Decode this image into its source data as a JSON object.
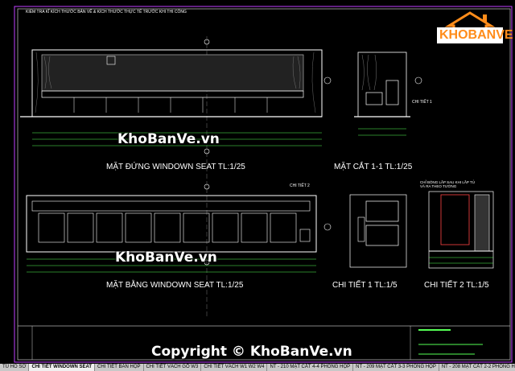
{
  "sheet": {
    "header_note": "KIỂM TRA KĨ KÍCH THƯỚC BẢN VẼ & KÍCH THƯỚC THỰC TẾ TRƯỚC KHI THI CÔNG",
    "titles": {
      "elevation": "MẶT ĐỨNG WINDOWN SEAT   TL:1/25",
      "section": "MẶT CẮT 1-1   TL:1/25",
      "plan": "MẶT BẰNG WINDOWN SEAT   TL:1/25",
      "detail1": "CHI TIẾT 1   TL:1/5",
      "detail2": "CHI TIẾT 2   TL:1/5"
    },
    "detail_note": "CHI TIẾT 1",
    "detail_note2": "CHI TIẾT 2",
    "detail2_callout": "CHỈ BÓNG LẮP SAU KHI LẮP TỦ VÀ RA THEO TƯỜNG"
  },
  "logo": {
    "text": "KHOBANVE",
    "house_color": "#ff8c1a",
    "brand_color": "#ff8c1a"
  },
  "watermarks": {
    "top": "KhoBanVe.vn",
    "middle": "KhoBanVe.vn",
    "copyright": "Copyright © KhoBanVe.vn"
  },
  "tabs": [
    {
      "label": "TỦ HỒ SƠ",
      "active": false
    },
    {
      "label": "CHI TIẾT WINDOWN SEAT",
      "active": true
    },
    {
      "label": "CHI TIẾT BÀN HỌP",
      "active": false
    },
    {
      "label": "CHI TIẾT VÁCH GỖ W3",
      "active": false
    },
    {
      "label": "CHI TIẾT VÁCH W1  W2  W4",
      "active": false
    },
    {
      "label": "NT - 210 MẶT CẮT 4-4  PHÒNG HỌP",
      "active": false
    },
    {
      "label": "NT - 209 MẶT CẮT 3-3  PHÒNG HỌP",
      "active": false
    },
    {
      "label": "NT - 208 MẶT CẮT 2-2  PHÒNG H",
      "active": false
    }
  ],
  "colors": {
    "frame": "#b0b0b0",
    "line": "#ffffff",
    "dim": "#55ff55",
    "accent": "#ff4444",
    "border": "#c040ff"
  }
}
